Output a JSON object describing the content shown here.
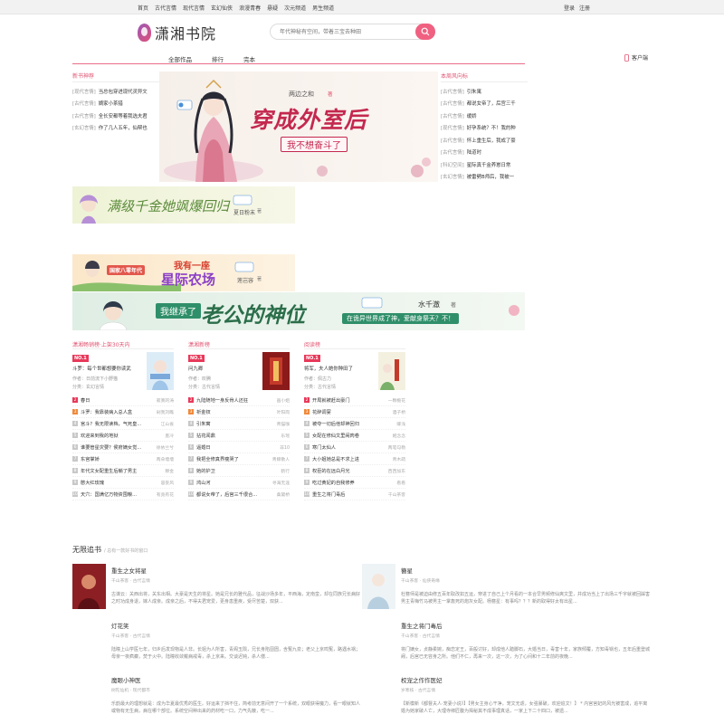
{
  "topnav": [
    "首页",
    "古代言情",
    "现代言情",
    "玄幻仙侠",
    "浪漫青春",
    "悬疑",
    "次元频道",
    "男生频道"
  ],
  "toplinks": [
    "登录",
    "注册"
  ],
  "logo": "潇湘书院",
  "search_placeholder": "年代神秘有空间，带着三宝去种田",
  "nav": [
    "全部作品",
    "排行",
    "完本"
  ],
  "client": "客户端",
  "left_list": {
    "title": "新书神荐",
    "items": [
      {
        "tag": "[现代言情]",
        "title": "当总包穿进现代灵异文"
      },
      {
        "tag": "[古代言情]",
        "title": "嫡家小茶猎"
      },
      {
        "tag": "[古代言情]",
        "title": "全长安都等着我选夫君"
      },
      {
        "tag": "[玄幻言情]",
        "title": "作了几人五年，仙帮也"
      }
    ]
  },
  "right_list": {
    "title": "本周风向标",
    "items": [
      {
        "tag": "[古代言情]",
        "title": "引朱寓"
      },
      {
        "tag": "[古代言情]",
        "title": "都说女帝了，后宫三千"
      },
      {
        "tag": "[古代言情]",
        "title": "缓娇"
      },
      {
        "tag": "[现代言情]",
        "title": "好孕系统？不！我的种"
      },
      {
        "tag": "[古代言情]",
        "title": "怀上重生后，我成了豪"
      },
      {
        "tag": "[古代言情]",
        "title": "陆道时"
      },
      {
        "tag": "[科幻空间]",
        "title": "星际真千金养崽日常"
      },
      {
        "tag": "[玄幻言情]",
        "title": "被雷劈B师后，我被一"
      }
    ]
  },
  "banners": {
    "main": {
      "title": "穿成外室后",
      "subtitle": "我不想奋斗了",
      "author": "两边之和",
      "author_suffix": "著"
    },
    "b2": {
      "title": "满级千金她飒爆回归",
      "author": "夏日粉末",
      "author_suffix": "著"
    },
    "b3": {
      "title_top": "我有一座",
      "title": "星际农场",
      "era": "国家八零年代",
      "author": "莲岂容",
      "author_suffix": "著"
    },
    "b4": {
      "title_pre": "我继承了",
      "title": "老公的神位",
      "slogan": "在诡异世界成了神，爱献身祭天？不！",
      "author": "水千澈",
      "author_suffix": "著"
    },
    "brand": "潇湘书院"
  },
  "rankings": [
    {
      "title": "潇湘畅销榜·上架30天内",
      "no1": "NO.1",
      "top_title": "斗罗：每个世都想要你读武",
      "top_author": "作者：日前流下小野猫",
      "top_cat": "分类：玄幻言情",
      "rows": [
        [
          "春日",
          "寂寞的涛"
        ],
        [
          "斗罗：我靠装病入总人盒",
          "剁我刘瞧"
        ],
        [
          "宫斗？我无限读档，气死皇...",
          "江山雀"
        ],
        [
          "欢迎来到我的地狱",
          "墨冷"
        ],
        [
          "谁要管星灾要？侯府嫡女觉...",
          "徐依兰兮"
        ],
        [
          "东宫掌娇",
          "两朵墙墙"
        ],
        [
          "年代文女配重生后躺了男主",
          "穆金"
        ],
        [
          "憨大红玫瑰",
          "容妄风"
        ],
        [
          "天穴：国满亿万物资囤粮...",
          "有竟有花"
        ]
      ]
    },
    {
      "title": "潇湘新榜",
      "no1": "NO.1",
      "top_title": "问九卿",
      "top_author": "作者：叹腾",
      "top_cat": "分类：古代言情",
      "rows": [
        [
          "九陆随地一身反骨人还狂",
          "画小姐"
        ],
        [
          "祈金钗",
          "叶阳岗"
        ],
        [
          "引朱寓",
          "青猫咖"
        ],
        [
          "拈花闻鼎",
          "乐瑶"
        ],
        [
          "逼婚日",
          "非10"
        ],
        [
          "我把全修真界瘦哭了",
          "青鲸散人"
        ],
        [
          "她的护卫",
          "鹤行"
        ],
        [
          "鸿山河",
          "寻海无涯"
        ],
        [
          "都说女帝了，后宫三千很合...",
          "桑黛桥"
        ]
      ]
    },
    {
      "title": "阅读榜",
      "no1": "NO.1",
      "top_title": "将军，夫人她你种田了",
      "top_author": "作者：佩古力",
      "top_cat": "分类：古代言情",
      "rows": [
        [
          "开局就被赶出豪门",
          "一颗栀花"
        ],
        [
          "花醉调宴",
          "酒子桥"
        ],
        [
          "被夺一切后他却神回归",
          "卿浅"
        ],
        [
          "女配在修仙文里闹肉卷",
          "姬念念"
        ],
        [
          "寒门太仙人",
          "两笔勾勒"
        ],
        [
          "大小姐她总是不求上进",
          "青木疏"
        ],
        [
          "权臣的在远白月光",
          "西西加东"
        ],
        [
          "吃过黄妃的自我修养",
          "看看"
        ],
        [
          "重生之将门毒后",
          "千山茶客"
        ]
      ]
    }
  ],
  "infinite": {
    "title": "无限追书",
    "subtitle": "/ 总有一款好书的窗口"
  },
  "cards": [
    {
      "title": "重生之女将星",
      "meta": "千山茶客 · 古代言情",
      "desc": "古谋云：关西出将，关东出相。大豪是天生的将星。她是兄长的雅代品，征战沙场多年，平西海，定南蛮，却在同族兄长病好之时功成身退，嫁人成亲。成亲之后，不得夫君宠爱，更身患重疾，受尽苦楚，双获..."
    },
    {
      "title": "簪星",
      "meta": "千山茶客 · 仙侠奇缘",
      "desc": "杜簪师是被迫由修五百年取改如五运，穿进了自己上个月看的一本合早男频修仙爽文里，并成功当上了出场三千字就被回踩害男主青梅竹马被男主一掌轰死的炮灰女配。杨簪星：有事吗？？？新的取得好太有出星..."
    },
    {
      "title": "灯花笑",
      "meta": "千山茶客 · 古代言情",
      "desc": "陆瞳上山学医七年，归乡后发现物是人非。长姐为人所害，青阁玉陨，兄长身陷囹圄，含冤九泉；老父上京鸣冤，路遇水祸；母亲一夜疯癫，焚于火中。陆瞳收敛戴病戒毒，杀上京来。交谈迟钝，杀人偿..."
    },
    {
      "title": "重生之将门毒后",
      "meta": "千山茶客 · 古代言情",
      "desc": "将门嫡女，贞静柔婉，痴恋定王，百般讨好，却成他人踏脚石，大婚当日，毒害十年，家族倾覆，方知毒锅也，五年后重登城阙，后宫已无容身之所。他们不仁，再来一次，这一次，为了心间和十二年前的夜晚... "
    },
    {
      "title": "魔眼小神医",
      "meta": "树陀仙机 · 现代都市",
      "desc": "乐韵最大的理想就是：成为华夏最优秀的医生。好运来了挡不住，简考前无意间开了一个系统，双眼获得魔力，看一眼就知人或物有无生病，病在哪个部位。系统空间种出来的药材吃一口，力气先蔽，吃一..."
    },
    {
      "title": "权宠之作作医妃",
      "meta": "岁寒枝 · 古代言情",
      "desc": "【新模新《都督夫人·宠妻小说》】【男女主身心干净，宠文无虐，女强暴破，欢迎追文！】 * 内宫宫妃的风光被害成，追平离婚为她家破人亡，大理寺绑匠腹为揭秘其不成事理真话，一家上下二十四口，被遗..."
    }
  ]
}
